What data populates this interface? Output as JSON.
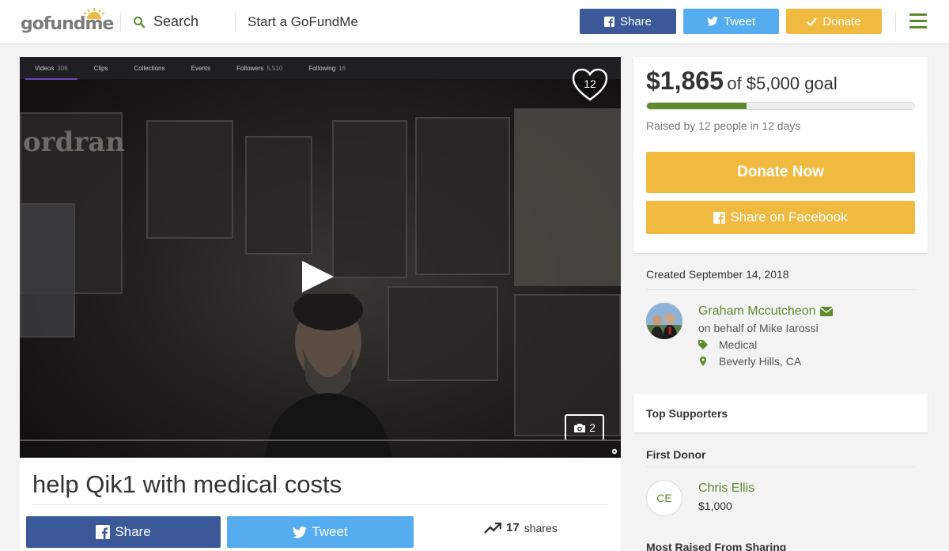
{
  "header": {
    "logo": "gofundme",
    "search_label": "Search",
    "start_label": "Start a GoFundMe",
    "share_label": "Share",
    "tweet_label": "Tweet",
    "donate_label": "Donate"
  },
  "media": {
    "twitch_tabs": [
      {
        "label": "Videos",
        "count": "306"
      },
      {
        "label": "Clips",
        "count": ""
      },
      {
        "label": "Collections",
        "count": ""
      },
      {
        "label": "Events",
        "count": ""
      },
      {
        "label": "Followers",
        "count": "5,510"
      },
      {
        "label": "Following",
        "count": "16"
      }
    ],
    "heart_count": "12",
    "photo_count": "2"
  },
  "campaign": {
    "title": "help Qik1 with medical costs",
    "share_label": "Share",
    "tweet_label": "Tweet",
    "shares_count": "17",
    "shares_label": "shares"
  },
  "donation": {
    "raised": "$1,865",
    "goal_text": "of $5,000 goal",
    "progress_fraction": 0.373,
    "raised_by": "Raised by 12 people in 12 days",
    "donate_now": "Donate Now",
    "share_facebook": "Share on Facebook"
  },
  "details": {
    "created": "Created September 14, 2018",
    "organizer": "Graham Mccutcheon",
    "behalf": "on behalf of Mike Iarossi",
    "category": "Medical",
    "location": "Beverly Hills, CA"
  },
  "supporters": {
    "top_supporters": "Top Supporters",
    "first_donor_heading": "First Donor",
    "first_donor_initials": "CE",
    "first_donor_name": "Chris Ellis",
    "first_donor_amount": "$1,000",
    "most_raised": "Most Raised From Sharing"
  },
  "colors": {
    "brand_green": "#5c8a2d",
    "facebook": "#3b5998",
    "twitter": "#55acee",
    "donate": "#f0b940"
  }
}
